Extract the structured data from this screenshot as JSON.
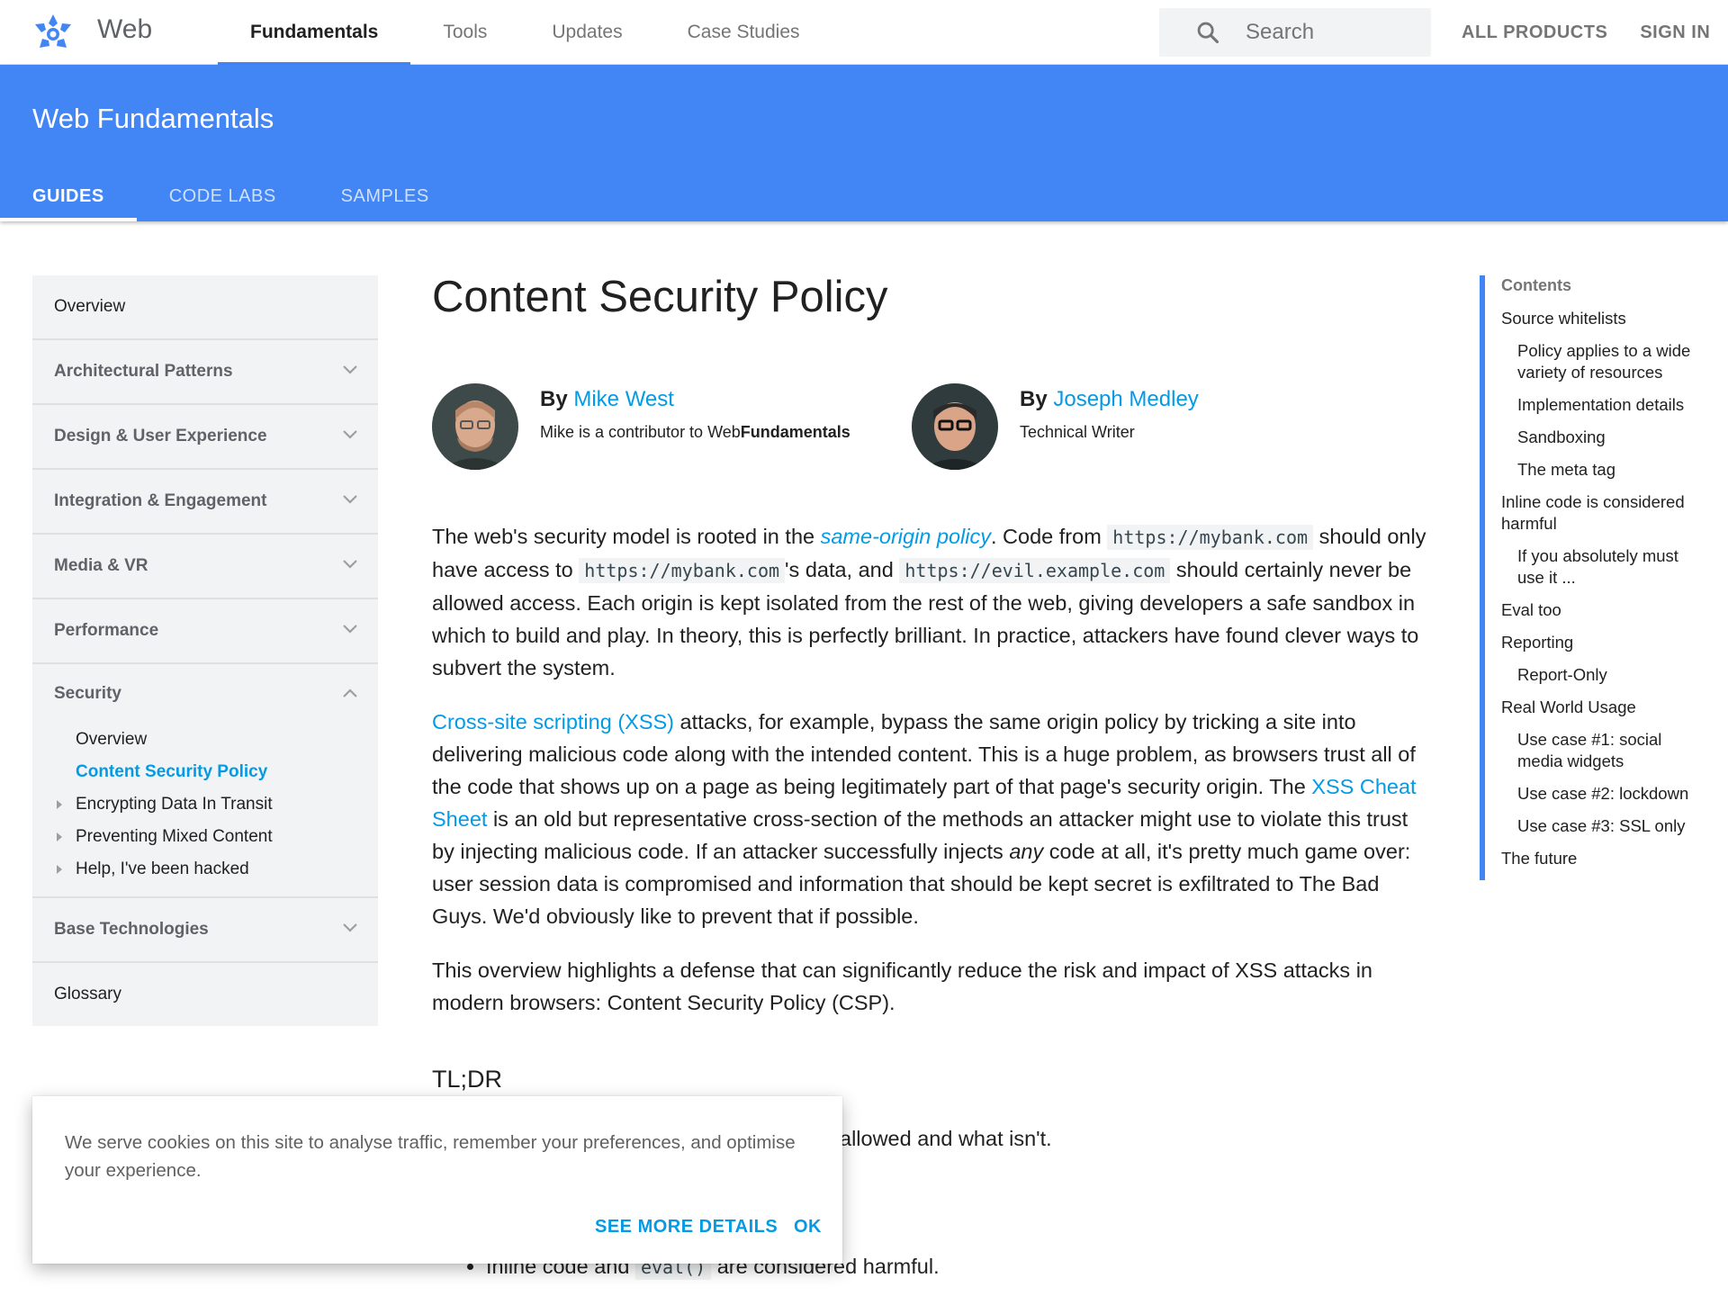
{
  "topbar": {
    "brand": "Web",
    "tabs": [
      {
        "label": "Fundamentals",
        "active": true
      },
      {
        "label": "Tools",
        "active": false
      },
      {
        "label": "Updates",
        "active": false
      },
      {
        "label": "Case Studies",
        "active": false
      }
    ],
    "search_placeholder": "Search",
    "all_products": "ALL PRODUCTS",
    "sign_in": "SIGN IN"
  },
  "hero": {
    "title": "Web Fundamentals",
    "tabs": [
      {
        "label": "GUIDES",
        "active": true
      },
      {
        "label": "CODE LABS",
        "active": false
      },
      {
        "label": "SAMPLES",
        "active": false
      }
    ]
  },
  "sidebar": {
    "overview": "Overview",
    "groups": [
      "Architectural Patterns",
      "Design & User Experience",
      "Integration & Engagement",
      "Media & VR",
      "Performance"
    ],
    "security": {
      "label": "Security",
      "children": [
        {
          "label": "Overview",
          "active": false,
          "expandable": false
        },
        {
          "label": "Content Security Policy",
          "active": true,
          "expandable": false
        },
        {
          "label": "Encrypting Data In Transit",
          "active": false,
          "expandable": true
        },
        {
          "label": "Preventing Mixed Content",
          "active": false,
          "expandable": true
        },
        {
          "label": "Help, I've been hacked",
          "active": false,
          "expandable": true
        }
      ]
    },
    "base": "Base Technologies",
    "glossary": "Glossary"
  },
  "article": {
    "title": "Content Security Policy",
    "authors": [
      {
        "by": "By",
        "name": "Mike West",
        "desc_pre": "Mike is a contributor to Web",
        "desc_bold": "Fundamentals"
      },
      {
        "by": "By",
        "name": "Joseph Medley",
        "desc_pre": "Technical Writer",
        "desc_bold": ""
      }
    ],
    "p1": {
      "t1": "The web's security model is rooted in the ",
      "link1": "same-origin policy",
      "t2": ". Code from ",
      "code1": "https://mybank.com",
      "t3": " should only have access to ",
      "code2": "https://mybank.com",
      "t4": "'s data, and ",
      "code3": "https://evil.example.com",
      "t5": " should certainly never be allowed access. Each origin is kept isolated from the rest of the web, giving developers a safe sandbox in which to build and play. In theory, this is perfectly brilliant. In practice, attackers have found clever ways to subvert the system."
    },
    "p2": {
      "link1": "Cross-site scripting (XSS)",
      "t1": " attacks, for example, bypass the same origin policy by tricking a site into delivering malicious code along with the intended content. This is a huge problem, as browsers trust all of the code that shows up on a page as being legitimately part of that page's security origin. The ",
      "link2": "XSS Cheat Sheet",
      "t2": " is an old but representative cross-section of the methods an attacker might use to violate this trust by injecting malicious code. If an attacker successfully injects ",
      "em": "any",
      "t3": " code at all, it's pretty much game over: user session data is compromised and information that should be kept secret is exfiltrated to The Bad Guys. We'd obviously like to prevent that if possible."
    },
    "p3": "This overview highlights a defense that can significantly reduce the risk and impact of XSS attacks in modern browsers: Content Security Policy (CSP).",
    "tldr": "TL;DR",
    "tldr_partial": "allowed and what isn't.",
    "bullet_pre": "Inline code and ",
    "bullet_code": "eval()",
    "bullet_post": " are considered harmful."
  },
  "toc": {
    "title": "Contents",
    "items": [
      {
        "label": "Source whitelists",
        "sub": false
      },
      {
        "label": "Policy applies to a wide variety of resources",
        "sub": true
      },
      {
        "label": "Implementation details",
        "sub": true
      },
      {
        "label": "Sandboxing",
        "sub": true
      },
      {
        "label": "The meta tag",
        "sub": true
      },
      {
        "label": "Inline code is considered harmful",
        "sub": false
      },
      {
        "label": "If you absolutely must use it ...",
        "sub": true
      },
      {
        "label": "Eval too",
        "sub": false
      },
      {
        "label": "Reporting",
        "sub": false
      },
      {
        "label": "Report-Only",
        "sub": true
      },
      {
        "label": "Real World Usage",
        "sub": false
      },
      {
        "label": "Use case #1: social media widgets",
        "sub": true
      },
      {
        "label": "Use case #2: lockdown",
        "sub": true
      },
      {
        "label": "Use case #3: SSL only",
        "sub": true
      },
      {
        "label": "The future",
        "sub": false
      }
    ]
  },
  "cookie": {
    "text": "We serve cookies on this site to analyse traffic, remember your preferences, and optimise your experience.",
    "details": "SEE MORE DETAILS",
    "ok": "OK"
  },
  "colors": {
    "brand_blue": "#4285f4",
    "link": "#039be5",
    "sidebar_bg": "#f1f3f4"
  },
  "icons": [
    "web-logo-icon",
    "search-icon",
    "chevron-down-icon",
    "chevron-up-icon",
    "expand-triangle-icon"
  ]
}
